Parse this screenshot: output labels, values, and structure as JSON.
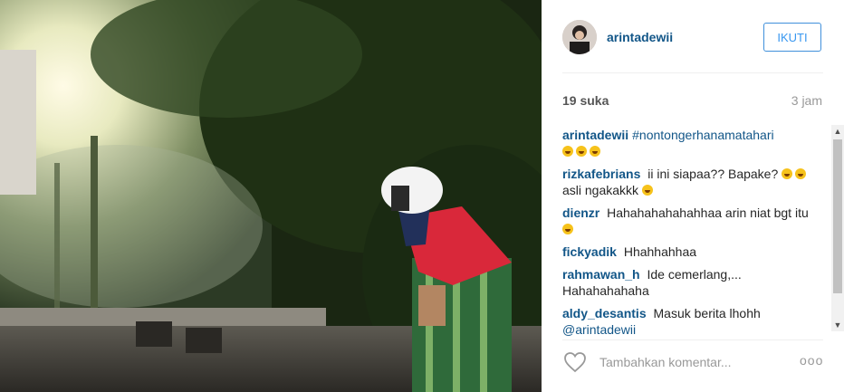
{
  "post": {
    "username": "arintadewii",
    "follow_label": "IKUTI",
    "likes": "19 suka",
    "time": "3 jam"
  },
  "comments": [
    {
      "user": "arintadewii",
      "hashtag": "#nontongerhanamatahari",
      "text": "",
      "emoji_count": 3
    },
    {
      "user": "rizkafebrians",
      "text": "ii ini siapaa?? Bapake?",
      "text2": "asli ngakakkk",
      "emoji_count": 2
    },
    {
      "user": "dienzr",
      "text": "Hahahahahahahhaa arin niat bgt itu",
      "emoji_count": 1
    },
    {
      "user": "fickyadik",
      "text": "Hhahhahhaa"
    },
    {
      "user": "rahmawan_h",
      "text": "Ide cemerlang,... Hahahahahaha"
    },
    {
      "user": "aldy_desantis",
      "text": "Masuk berita lhohh",
      "mention": "@arintadewii"
    }
  ],
  "footer": {
    "comment_placeholder": "Tambahkan komentar...",
    "more_label": "ooo"
  },
  "icons": [
    "heart-icon",
    "more-options-icon",
    "scroll-up-icon",
    "scroll-down-icon"
  ],
  "colors": {
    "link": "#125688",
    "follow": "#3897f0",
    "muted": "#999999"
  }
}
